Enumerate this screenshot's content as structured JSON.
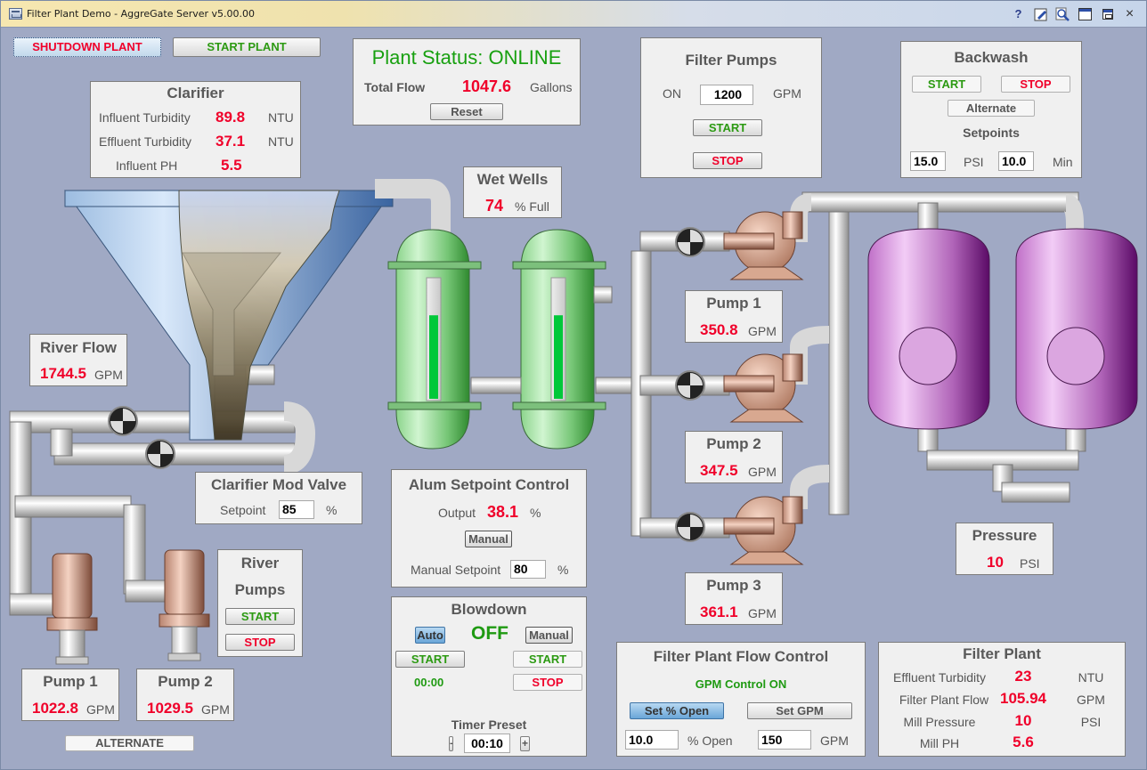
{
  "window": {
    "title": "Filter Plant Demo - AggreGate Server v5.00.00",
    "title_buttons": [
      "help-icon",
      "edit-icon",
      "zoom-icon",
      "maximize-icon",
      "restore-icon",
      "close-icon"
    ],
    "help_glyph": "?",
    "close_glyph": "×"
  },
  "colors": {
    "background": "#a0a9c4",
    "value_red": "#f0002a",
    "status_green": "#1f9a12",
    "panel": "#f0f0f0"
  },
  "top_buttons": {
    "shutdown": "SHUTDOWN PLANT",
    "start": "START PLANT"
  },
  "plant_status": {
    "title": "Plant Status: ONLINE",
    "total_flow_label": "Total Flow",
    "total_flow_value": "1047.6",
    "total_flow_unit": "Gallons",
    "reset_label": "Reset"
  },
  "filter_pumps": {
    "title": "Filter Pumps",
    "on_label": "ON",
    "setpoint": "1200",
    "unit": "GPM",
    "start_label": "START",
    "stop_label": "STOP"
  },
  "backwash": {
    "title": "Backwash",
    "start_label": "START",
    "stop_label": "STOP",
    "alternate_label": "Alternate",
    "setpoints_label": "Setpoints",
    "psi_value": "15.0",
    "psi_unit": "PSI",
    "min_value": "10.0",
    "min_unit": "Min"
  },
  "clarifier": {
    "title": "Clarifier",
    "rows": [
      {
        "label": "Influent Turbidity",
        "value": "89.8",
        "unit": "NTU"
      },
      {
        "label": "Effluent Turbidity",
        "value": "37.1",
        "unit": "NTU"
      },
      {
        "label": "Influent PH",
        "value": "5.5",
        "unit": ""
      }
    ]
  },
  "wet_wells": {
    "title": "Wet Wells",
    "value": "74",
    "unit": "% Full",
    "tank_levels_percent": [
      70,
      70
    ]
  },
  "river_flow": {
    "title": "River Flow",
    "value": "1744.5",
    "unit": "GPM"
  },
  "clarifier_mod_valve": {
    "title": "Clarifier Mod Valve",
    "setpoint_label": "Setpoint",
    "setpoint_value": "85",
    "unit": "%"
  },
  "river_pumps": {
    "title_line1": "River",
    "title_line2": "Pumps",
    "start_label": "START",
    "stop_label": "STOP",
    "alternate_label": "ALTERNATE",
    "pumps": [
      {
        "name": "Pump 1",
        "value": "1022.8",
        "unit": "GPM"
      },
      {
        "name": "Pump 2",
        "value": "1029.5",
        "unit": "GPM"
      }
    ]
  },
  "alum": {
    "title": "Alum Setpoint Control",
    "output_label": "Output",
    "output_value": "38.1",
    "output_unit": "%",
    "manual_label": "Manual",
    "manual_setpoint_label": "Manual Setpoint",
    "manual_setpoint_value": "80",
    "manual_setpoint_unit": "%"
  },
  "blowdown": {
    "title": "Blowdown",
    "auto_label": "Auto",
    "state": "OFF",
    "manual_label": "Manual",
    "auto_start_label": "START",
    "manual_start_label": "START",
    "manual_stop_label": "STOP",
    "timer": "00:00",
    "timer_preset_label": "Timer Preset",
    "timer_preset_value": "00:10",
    "minus_label": "-",
    "plus_label": "+"
  },
  "filter_pumps_readouts": [
    {
      "name": "Pump 1",
      "value": "350.8",
      "unit": "GPM"
    },
    {
      "name": "Pump 2",
      "value": "347.5",
      "unit": "GPM"
    },
    {
      "name": "Pump 3",
      "value": "361.1",
      "unit": "GPM"
    }
  ],
  "pressure": {
    "title": "Pressure",
    "value": "10",
    "unit": "PSI"
  },
  "flow_control": {
    "title": "Filter Plant Flow Control",
    "status": "GPM Control ON",
    "set_open_label": "Set % Open",
    "set_gpm_label": "Set GPM",
    "open_value": "10.0",
    "open_unit": "% Open",
    "gpm_value": "150",
    "gpm_unit": "GPM"
  },
  "filter_plant": {
    "title": "Filter Plant",
    "rows": [
      {
        "label": "Effluent Turbidity",
        "value": "23",
        "unit": "NTU"
      },
      {
        "label": "Filter Plant Flow",
        "value": "105.94",
        "unit": "GPM"
      },
      {
        "label": "Mill Pressure",
        "value": "10",
        "unit": "PSI"
      },
      {
        "label": "Mill PH",
        "value": "5.6",
        "unit": ""
      }
    ]
  }
}
